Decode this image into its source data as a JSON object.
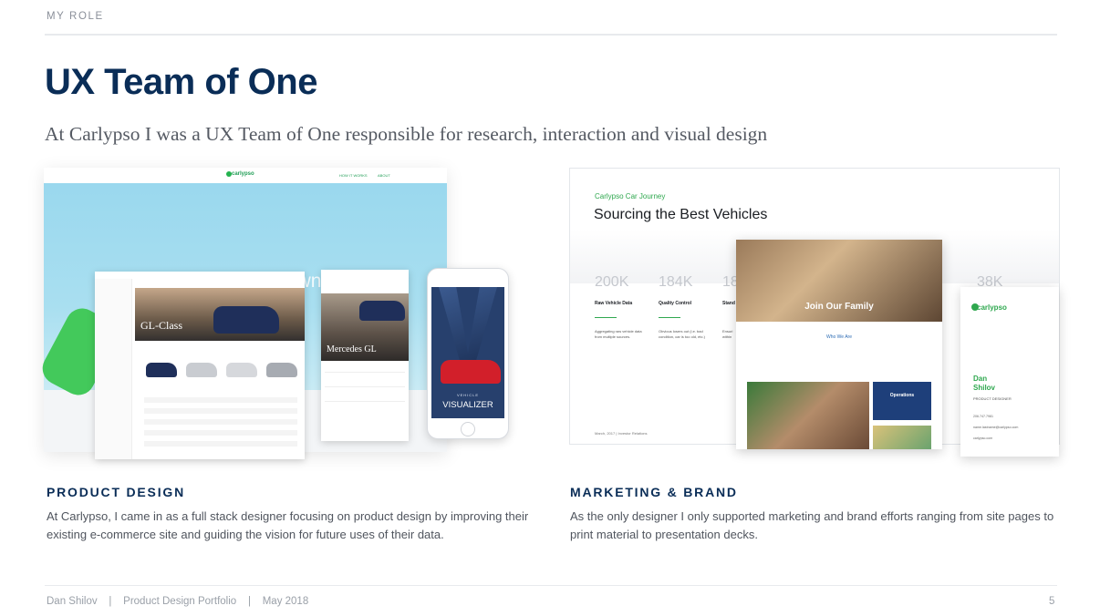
{
  "header": {
    "section_label": "MY ROLE",
    "title": "UX Team of One",
    "subtitle": "At Carlypso I was a UX Team of One responsible for research, interaction and visual design"
  },
  "product_mockup": {
    "logo": "carlypso",
    "nav": [
      "HOW IT WORKS",
      "ABOUT"
    ],
    "hero_text": "Your Perfect Pre-Owned",
    "card_model": "GL-Class",
    "phone_model": "Mercedes GL",
    "visualizer_small": "VEHICLE",
    "visualizer_label": "VISUALIZER"
  },
  "marketing_mockup": {
    "kicker": "Carlypso Car Journey",
    "heading": "Sourcing the Best Vehicles",
    "stats": [
      {
        "value": "200K",
        "label": "Raw Vehicle Data",
        "text": "Aggregating raw vehicle data from multiple sources."
      },
      {
        "value": "184K",
        "label": "Quality Control",
        "text": "Obvious losers out (i.e. bad condition, car is too old, etc.)"
      },
      {
        "value": "18",
        "label": "Stand",
        "text": "Ensuri within"
      }
    ],
    "stat_extra": "38K",
    "footer_text": "March, 2017   |   Investor Relations",
    "card_join": "Join Our Family",
    "card_who": "Who We Are",
    "card_ops": "Operations",
    "biz_logo": "carlypso",
    "biz_name_first": "Dan",
    "biz_name_last": "Shilov",
    "biz_role": "PRODUCT DESIGNER",
    "biz_phone": "206.747.7981",
    "biz_email": "name.lastname@carlypso.com",
    "biz_site": "carlypso.com"
  },
  "sections": {
    "product": {
      "heading": "PRODUCT DESIGN",
      "body": "At Carlypso, I came in as a full stack designer focusing on product design by improving their existing e-commerce site and guiding the vision for future uses of their data."
    },
    "marketing": {
      "heading": "MARKETING & BRAND",
      "body": "As the only designer I only supported marketing and brand efforts ranging from site pages to print material to presentation decks."
    }
  },
  "footer": {
    "text": "Dan Shilov    |    Product Design Portfolio    |    May 2018",
    "page_number": "5"
  },
  "colors": {
    "navy": "#0a2d57",
    "green": "#2fa84f",
    "gray_text": "#50555e"
  }
}
